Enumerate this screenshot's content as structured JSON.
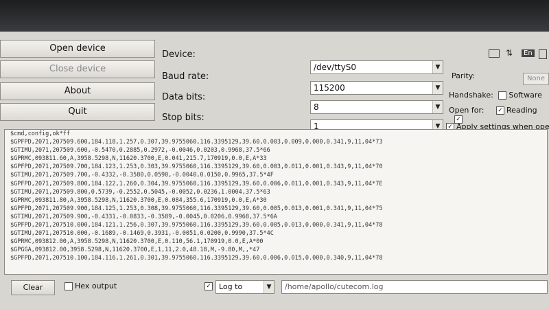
{
  "buttons": {
    "open": "Open device",
    "close": "Close device",
    "about": "About",
    "quit": "Quit"
  },
  "labels": {
    "device": "Device:",
    "baud": "Baud rate:",
    "data_bits": "Data bits:",
    "stop_bits": "Stop bits:",
    "parity": "Parity:",
    "handshake": "Handshake:",
    "open_for": "Open for:"
  },
  "values": {
    "device": "/dev/ttyS0",
    "baud": "115200",
    "data_bits": "8",
    "stop_bits": "1",
    "parity": "None"
  },
  "options": {
    "software": "Software",
    "reading": "Reading",
    "apply": "Apply settings when opening"
  },
  "console_lines": [
    "$cmd,config,ok*ff",
    "$GPFPD,2071,207509.600,184.118,1.257,0.307,39.9755060,116.3395129,39.60,0.003,0.009,0.000,0.341,9,11,04*73",
    "$GTIMU,2071,207509.600,-0.5470,0.2885,0.2972,-0.0046,0.0203,0.9968,37.5*66",
    "$GPRMC,093811.60,A,3958.5298,N,11620.3700,E,0.041,215.7,170919,0.0,E,A*33",
    "$GPFPD,2071,207509.700,184.123,1.253,0.303,39.9755060,116.3395129,39.60,0.003,0.011,0.001,0.343,9,11,04*70",
    "$GTIMU,2071,207509.700,-0.4332,-0.3580,0.0590,-0.0040,0.0150,0.9965,37.5*4F",
    "$GPFPD,2071,207509.800,184.122,1.260,0.304,39.9755060,116.3395129,39.60,0.006,0.011,0.001,0.343,9,11,04*7E",
    "$GTIMU,2071,207509.800,0.5739,-0.2552,0.5045,-0.0052,0.0236,1.0004,37.5*63",
    "$GPRMC,093811.80,A,3958.5298,N,11620.3700,E,0.084,355.6,170919,0.0,E,A*30",
    "$GPFPD,2071,207509.900,184.125,1.253,0.308,39.9755060,116.3395129,39.60,0.005,0.013,0.001,0.341,9,11,04*75",
    "$GTIMU,2071,207509.900,-0.4331,-0.0833,-0.3589,-0.0045,0.0206,0.9968,37.5*6A",
    "$GPFPD,2071,207510.000,184.121,1.256,0.307,39.9755060,116.3395129,39.60,0.005,0.013,0.000,0.341,9,11,04*78",
    "$GTIMU,2071,207510.000,-0.1689,-0.1469,0.3931,-0.0051,0.0200,0.9990,37.5*4C",
    "$GPRMC,093812.00,A,3958.5298,N,11620.3700,E,0.110,56.1,170919,0.0,E,A*00",
    "$GPGGA,093812.00,3958.5298,N,11620.3700,E,1,11,2.0,48.18,M,-9.80,M,,*47",
    "$GPFPD,2071,207510.100,184.116,1.261,0.301,39.9755060,116.3395129,39.60,0.006,0.015,0.000,0.340,9,11,04*78"
  ],
  "bottom": {
    "clear": "Clear",
    "hex_output": "Hex output",
    "log_to": "Log to",
    "log_path": "/home/apollo/cutecom.log"
  },
  "tray": {
    "lang": "En"
  },
  "icons": [
    "chevron-down-icon",
    "checkbox-icon",
    "keyboard-icon",
    "network-icon",
    "battery-icon"
  ]
}
